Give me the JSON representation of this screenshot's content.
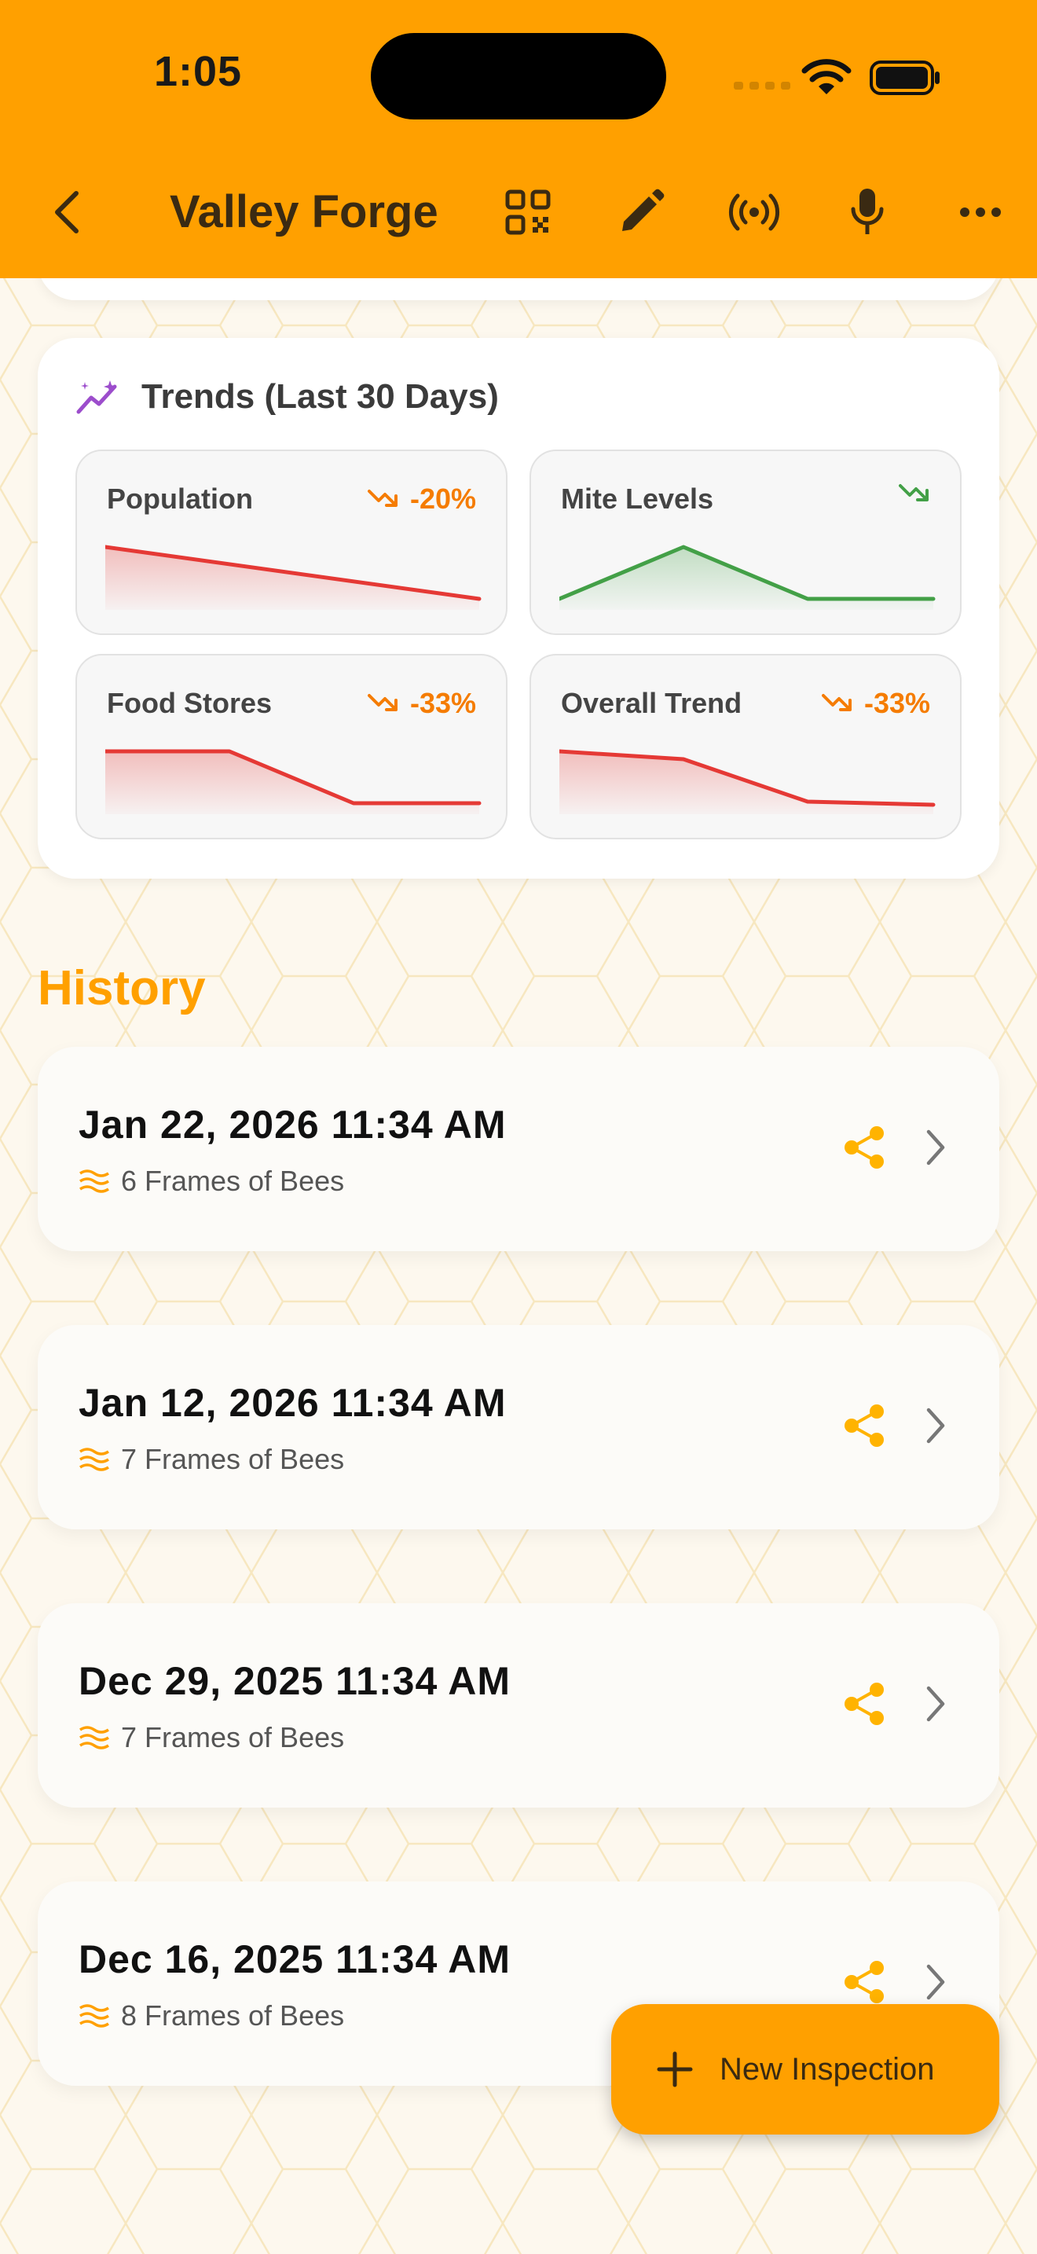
{
  "status_bar": {
    "time": "1:05"
  },
  "header": {
    "title": "Valley Forge",
    "actions": [
      "back-icon",
      "qr-code-icon",
      "edit-icon",
      "broadcast-icon",
      "microphone-icon",
      "more-icon"
    ],
    "color": "#FFA000"
  },
  "trends": {
    "title": "Trends (Last 30 Days)",
    "icon": "sparkle-trend-icon",
    "tiles": [
      {
        "label": "Population",
        "delta": "-20%",
        "direction": "down",
        "color": "#E53935",
        "delta_color": "#F57C00"
      },
      {
        "label": "Mite Levels",
        "delta": "",
        "direction": "down",
        "color": "#43A047",
        "delta_color": "#43A047"
      },
      {
        "label": "Food Stores",
        "delta": "-33%",
        "direction": "down",
        "color": "#E53935",
        "delta_color": "#F57C00"
      },
      {
        "label": "Overall Trend",
        "delta": "-33%",
        "direction": "down",
        "color": "#E53935",
        "delta_color": "#F57C00"
      }
    ]
  },
  "history": {
    "title": "History",
    "items": [
      {
        "date": "Jan 22, 2026 11:34 AM",
        "frames": "6 Frames of Bees"
      },
      {
        "date": "Jan 12, 2026 11:34 AM",
        "frames": "7 Frames of Bees"
      },
      {
        "date": "Dec 29, 2025 11:34 AM",
        "frames": "7 Frames of Bees"
      },
      {
        "date": "Dec 16, 2025 11:34 AM",
        "frames": "8 Frames of Bees"
      }
    ]
  },
  "fab": {
    "label": "New Inspection",
    "icon": "plus-icon"
  }
}
